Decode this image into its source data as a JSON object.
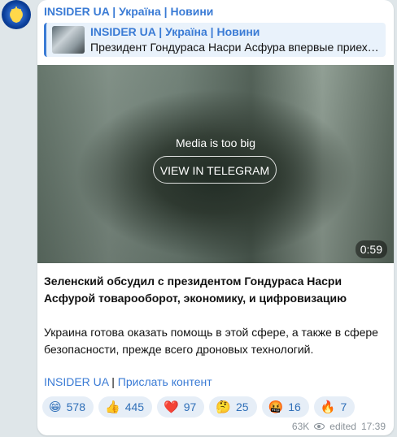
{
  "channel": {
    "name": "INSIDER UA | Україна | Новини"
  },
  "reply": {
    "title": "INSIDER UA | Україна | Новини",
    "text": "Президент Гондураса Насри Асфура впервые приеха…"
  },
  "media": {
    "message": "Media is too big",
    "button": "VIEW IN TELEGRAM",
    "duration": "0:59"
  },
  "post": {
    "title": "Зеленский обсудил с президентом Гондураса Насри Асфурой товарооборот, экономику, и цифровизацию",
    "body": "Украина готова оказать помощь в этой сфере, а также в сфере безопасности, прежде всего дроновых технологий.",
    "link_channel": "INSIDER UA",
    "separator": " | ",
    "link_submit": "Прислать контент"
  },
  "reactions": [
    {
      "emoji": "😁",
      "icon": "grin-emoji-icon",
      "count": "578"
    },
    {
      "emoji": "👍",
      "icon": "thumbs-up-emoji-icon",
      "count": "445"
    },
    {
      "emoji": "❤️",
      "icon": "heart-emoji-icon",
      "count": "97"
    },
    {
      "emoji": "🤔",
      "icon": "thinking-emoji-icon",
      "count": "25"
    },
    {
      "emoji": "🤬",
      "icon": "angry-emoji-icon",
      "count": "16"
    },
    {
      "emoji": "🔥",
      "icon": "fire-emoji-icon",
      "count": "7"
    }
  ],
  "meta": {
    "views": "63K",
    "edited": "edited",
    "time": "17:39"
  },
  "colors": {
    "accent": "#3a7bd5",
    "reaction_bg": "#e6eef7",
    "background": "#dfe6e9"
  }
}
